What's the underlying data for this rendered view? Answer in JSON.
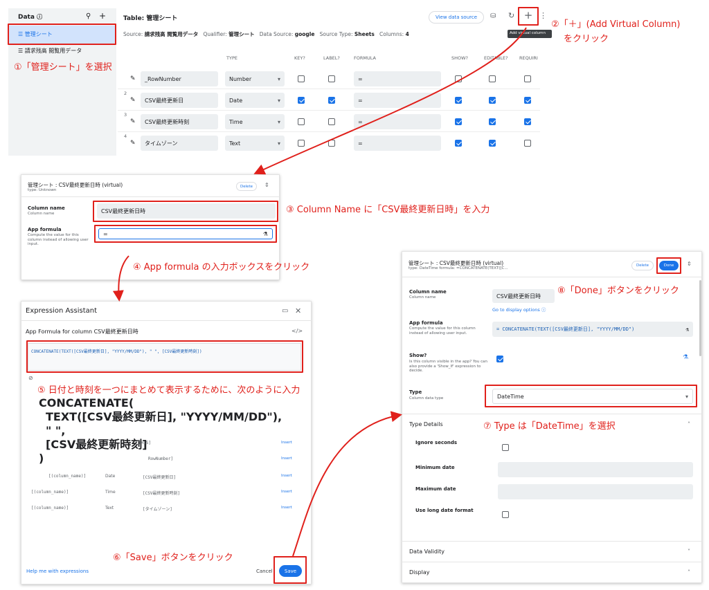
{
  "panel1": {
    "data_title": "Data",
    "tables": [
      "管理シート",
      "請求残高 閲覧用データ"
    ],
    "table_title": "Table: 管理シート",
    "view_source_label": "View data source",
    "tooltip": "Add virtual column",
    "meta": {
      "source_label": "Source:",
      "source_value": "請求残高 閲覧用データ",
      "qualifier_label": "Qualifier:",
      "qualifier_value": "管理シート",
      "datasource_label": "Data Source:",
      "datasource_value": "google",
      "sourcetype_label": "Source Type:",
      "sourcetype_value": "Sheets",
      "columns_label": "Columns:",
      "columns_value": "4"
    },
    "headers": [
      "TYPE",
      "KEY?",
      "LABEL?",
      "FORMULA",
      "SHOW?",
      "EDITABLE?",
      "REQUIRI"
    ],
    "rows": [
      {
        "num": "",
        "name": "_RowNumber",
        "type": "Number",
        "formula": "="
      },
      {
        "num": "2",
        "name": "CSV最終更新日",
        "type": "Date",
        "formula": "="
      },
      {
        "num": "3",
        "name": "CSV最終更新時刻",
        "type": "Time",
        "formula": "="
      },
      {
        "num": "4",
        "name": "タイムゾーン",
        "type": "Text",
        "formula": "="
      }
    ]
  },
  "panel2": {
    "title": "管理シート : CSV最終更新日時 (virtual)",
    "subtitle": "type: Unknown",
    "delete_label": "Delete",
    "colname_label": "Column name",
    "colname_sub": "Column name",
    "colname_value": "CSV最終更新日時",
    "formula_label": "App formula",
    "formula_sub": "Compute the value for this column instead of allowing user input.",
    "formula_value": "="
  },
  "panel3": {
    "title": "Expression Assistant",
    "subtitle": "App Formula for column CSV最終更新日時",
    "expression": "CONCATENATE(TEXT([CSV最終更新日], \"YYYY/MM/DD\"), \" \", [CSV最終更新時刻])",
    "rows": [
      {
        "col": "[(column_name)]",
        "type": "Date",
        "value": "[CSV最終更新日]",
        "action": "Insert"
      },
      {
        "col": "[(column_name)]",
        "type": "Time",
        "value": "[CSV最終更新時刻]",
        "action": "Insert"
      },
      {
        "col": "[(column_name)]",
        "type": "Text",
        "value": "[タイムゾーン]",
        "action": "Insert"
      }
    ],
    "partial_rows": [
      "THIS]",
      "RowNumber]",
      "Insert"
    ],
    "help_label": "Help me with expressions",
    "cancel_label": "Cancel",
    "save_label": "Save"
  },
  "panel4": {
    "title": "管理シート : CSV最終更新日時 (virtual)",
    "subtitle": "type: DateTime   formula: =CONCATENATE(TEXT([C...",
    "delete_label": "Delete",
    "done_label": "Done",
    "colname_label": "Column name",
    "colname_sub": "Column name",
    "colname_value": "CSV最終更新日時",
    "display_options": "Go to display options ⓘ",
    "formula_label": "App formula",
    "formula_sub": "Compute the value for this column instead of allowing user input.",
    "formula_value": "=  CONCATENATE(TEXT([CSV最終更新日], \"YYYY/MM/DD\")",
    "show_label": "Show?",
    "show_sub": "Is this column visible in the app? You can also provide a 'Show_If' expression to decide.",
    "type_label": "Type",
    "type_sub": "Column data type",
    "type_value": "DateTime",
    "type_details": "Type Details",
    "ignore_seconds": "Ignore seconds",
    "min_date": "Minimum date",
    "max_date": "Maximum date",
    "long_date": "Use long date format",
    "data_validity": "Data Validity",
    "display": "Display"
  },
  "annotations": {
    "a1": "①「管理シート」を選択",
    "a2_line1": "②「＋」(Add Virtual Column)",
    "a2_line2": "をクリック",
    "a3": "③ Column Name に「CSV最終更新日時」を入力",
    "a4": "④ App formula の入力ボックスをクリック",
    "a5": "⑤ 日付と時刻を一つにまとめて表示するために、次のように入力",
    "a5_code": [
      "CONCATENATE(",
      "TEXT([CSV最終更新日], \"YYYY/MM/DD\"),",
      "\" \",",
      "[CSV最終更新時刻]",
      ")"
    ],
    "a6": "⑥「Save」ボタンをクリック",
    "a7": "⑦ Type は「DateTime」を選択",
    "a8": "⑧「Done」ボタンをクリック"
  },
  "colors": {
    "accent": "#1a73e8",
    "annotation": "#e0201b"
  }
}
